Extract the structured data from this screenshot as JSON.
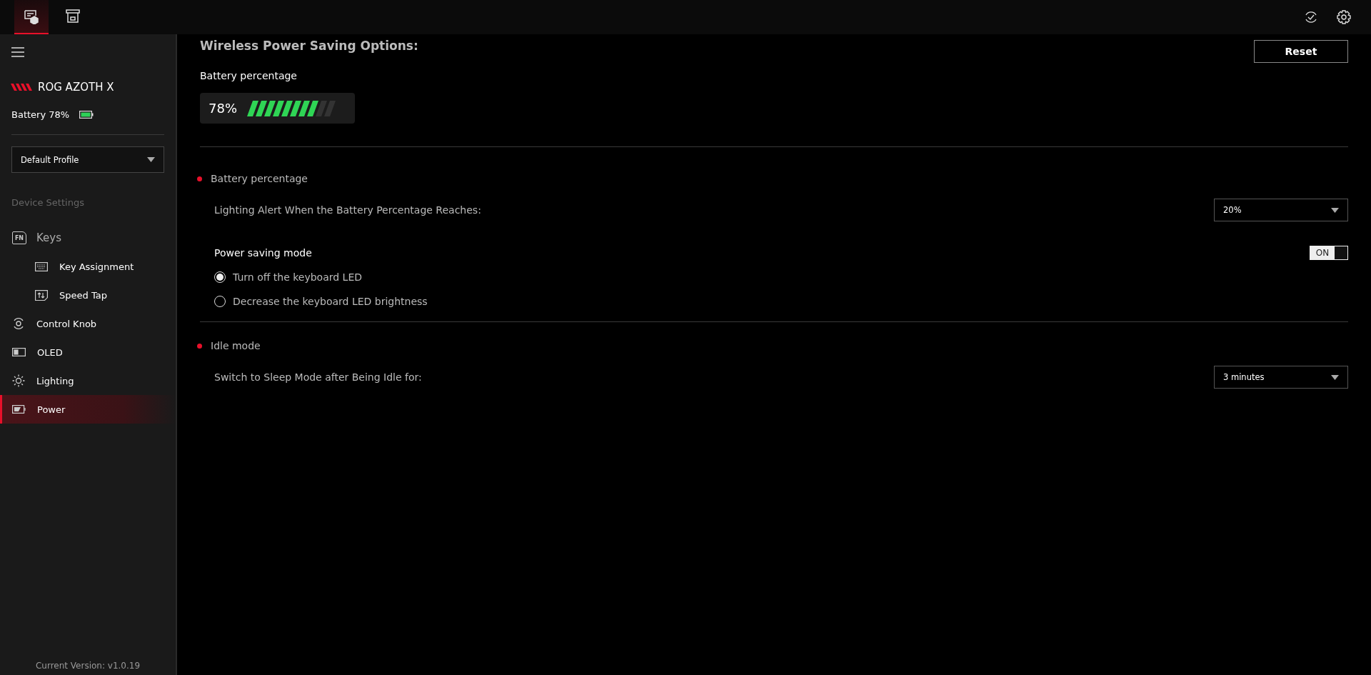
{
  "top_tabs": [
    {
      "selected": true
    },
    {
      "selected": false
    }
  ],
  "sidebar": {
    "device_name": "ROG AZOTH X",
    "battery": "Battery 78%",
    "profile": "Default Profile",
    "section_label": "Device Settings",
    "items": [
      {
        "label": "Keys",
        "icon_text": "FN",
        "kind": "group",
        "selected": false,
        "children": [
          {
            "label": "Key Assignment",
            "selected": false
          },
          {
            "label": "Speed Tap",
            "selected": false
          }
        ]
      },
      {
        "label": "Control Knob",
        "kind": "item",
        "selected": false
      },
      {
        "label": "OLED",
        "kind": "item",
        "selected": false
      },
      {
        "label": "Lighting",
        "kind": "item",
        "selected": false
      },
      {
        "label": "Power",
        "kind": "item",
        "selected": true
      }
    ],
    "version": "Current Version: v1.0.19"
  },
  "main": {
    "title": "Wireless Power Saving Options:",
    "reset": "Reset",
    "battery_label": "Battery percentage",
    "battery_meter": {
      "reading": "78%",
      "level": 0.78
    },
    "sections": [
      {
        "title": "Battery percentage",
        "alert_label": "Lighting Alert When the Battery Percentage Reaches:",
        "alert_value": "20%",
        "power_saving": {
          "title": "Power saving mode",
          "toggle": {
            "label": "ON",
            "on": true
          },
          "options": [
            {
              "label": "Turn off the keyboard LED",
              "selected": true
            },
            {
              "label": "Decrease the keyboard LED brightness",
              "selected": false
            }
          ]
        }
      },
      {
        "title": "Idle mode",
        "alert_label": "Switch to Sleep Mode after Being Idle for:",
        "alert_value": "3 minutes"
      }
    ]
  }
}
